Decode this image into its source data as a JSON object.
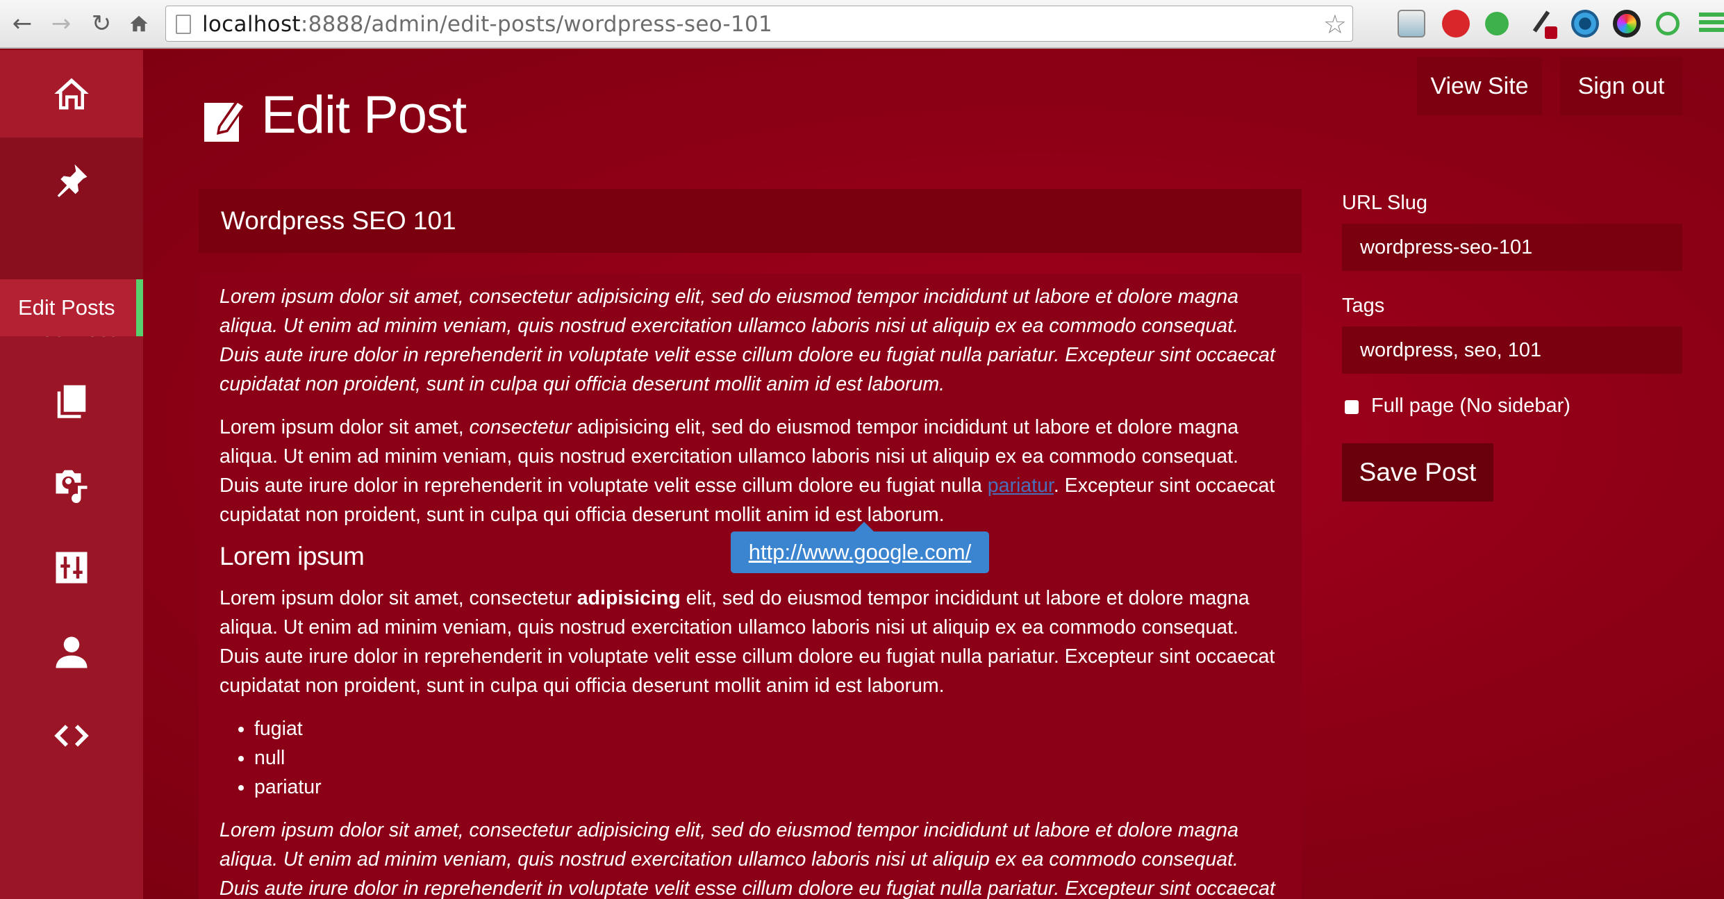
{
  "browser": {
    "url_host": "localhost",
    "url_path": ":8888/admin/edit-posts/wordpress-seo-101",
    "back_icon": "arrow-left-icon",
    "forward_icon": "arrow-right-icon",
    "reload_icon": "reload-icon",
    "home_icon": "home-icon",
    "bookmark_icon": "star-icon"
  },
  "sidebar": {
    "add_post_label": "Add Post",
    "edit_posts_label": "Edit Posts",
    "active_accent": "#58d06e"
  },
  "header": {
    "title": "Edit Post",
    "view_site": "View Site",
    "sign_out": "Sign out"
  },
  "post": {
    "title": "Wordpress SEO 101",
    "p1": "Lorem ipsum dolor sit amet, consectetur adipisicing elit, sed do eiusmod tempor incididunt ut labore et dolore magna aliqua. Ut enim ad minim veniam, quis nostrud exercitation ullamco laboris nisi ut aliquip ex ea commodo consequat. Duis aute irure dolor in reprehenderit in voluptate velit esse cillum dolore eu fugiat nulla pariatur. Excepteur sint occaecat cupidatat non proident, sunt in culpa qui officia deserunt mollit anim id est laborum.",
    "p2_a": "Lorem ipsum dolor sit amet, ",
    "p2_em": "consectetur",
    "p2_b": " adipisicing elit, sed do eiusmod tempor incididunt ut labore et dolore magna aliqua. Ut enim ad minim veniam, quis nostrud exercitation ullamco laboris nisi ut aliquip ex ea commodo consequat. Duis aute irure dolor in reprehenderit in voluptate velit esse cillum dolore eu fugiat nulla ",
    "p2_link": "pariatur",
    "p2_c": ". Excepteur sint occaecat cupidatat non proident, sunt in culpa qui officia deserunt mollit anim id est laborum.",
    "link_tooltip": "http://www.google.com/",
    "heading": "Lorem ipsum",
    "p3_a": "Lorem ipsum dolor sit amet, consectetur ",
    "p3_strong": "adipisicing",
    "p3_b": " elit, sed do eiusmod tempor incididunt ut labore et dolore magna aliqua. Ut enim ad minim veniam, quis nostrud exercitation ullamco laboris nisi ut aliquip ex ea commodo consequat. Duis aute irure dolor in reprehenderit in voluptate velit esse cillum dolore eu fugiat nulla pariatur. Excepteur sint occaecat cupidatat non proident, sunt in culpa qui officia deserunt mollit anim id est laborum.",
    "list": [
      "fugiat",
      "null",
      "pariatur"
    ],
    "p4": "Lorem ipsum dolor sit amet, consectetur adipisicing elit, sed do eiusmod tempor incididunt ut labore et dolore magna aliqua. Ut enim ad minim veniam, quis nostrud exercitation ullamco laboris nisi ut aliquip ex ea commodo consequat. Duis aute irure dolor in reprehenderit in voluptate velit esse cillum dolore eu fugiat nulla pariatur. Excepteur sint occaecat cupidatat non proident, sunt in culpa qui officia deserunt mollit anim id est laborum."
  },
  "settings": {
    "url_slug_label": "URL Slug",
    "url_slug_value": "wordpress-seo-101",
    "tags_label": "Tags",
    "tags_value": "wordpress, seo, 101",
    "full_page_label": "Full page (No sidebar)",
    "full_page_checked": false,
    "save_button": "Save Post"
  }
}
